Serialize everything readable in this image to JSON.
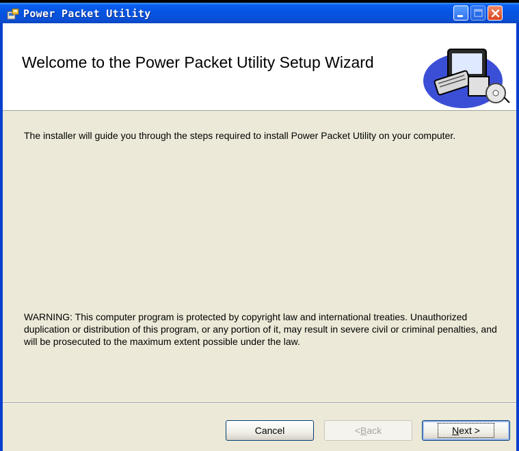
{
  "window": {
    "title": "Power Packet Utility",
    "title_icon": "installer-icon",
    "controls": {
      "minimize": "minimize-icon",
      "maximize": "maximize-icon",
      "close": "close-icon"
    }
  },
  "header": {
    "title": "Welcome to the Power Packet Utility  Setup Wizard",
    "art": "computer-cd-illustration"
  },
  "body": {
    "intro": "The installer will guide you through the steps required to install Power Packet Utility  on your computer.",
    "warning": "WARNING: This computer program is protected by copyright law and international treaties. Unauthorized duplication or distribution of this program, or any portion of it, may result in severe civil or criminal penalties, and will be prosecuted to the maximum extent possible under the law."
  },
  "buttons": {
    "cancel": "Cancel",
    "back_prefix": "< ",
    "back_key": "B",
    "back_rest": "ack",
    "next_key": "N",
    "next_rest": "ext >"
  },
  "colors": {
    "titlebar": "#0554e2",
    "client": "#ece9d8",
    "header": "#ffffff",
    "close_button": "#d8431c"
  }
}
